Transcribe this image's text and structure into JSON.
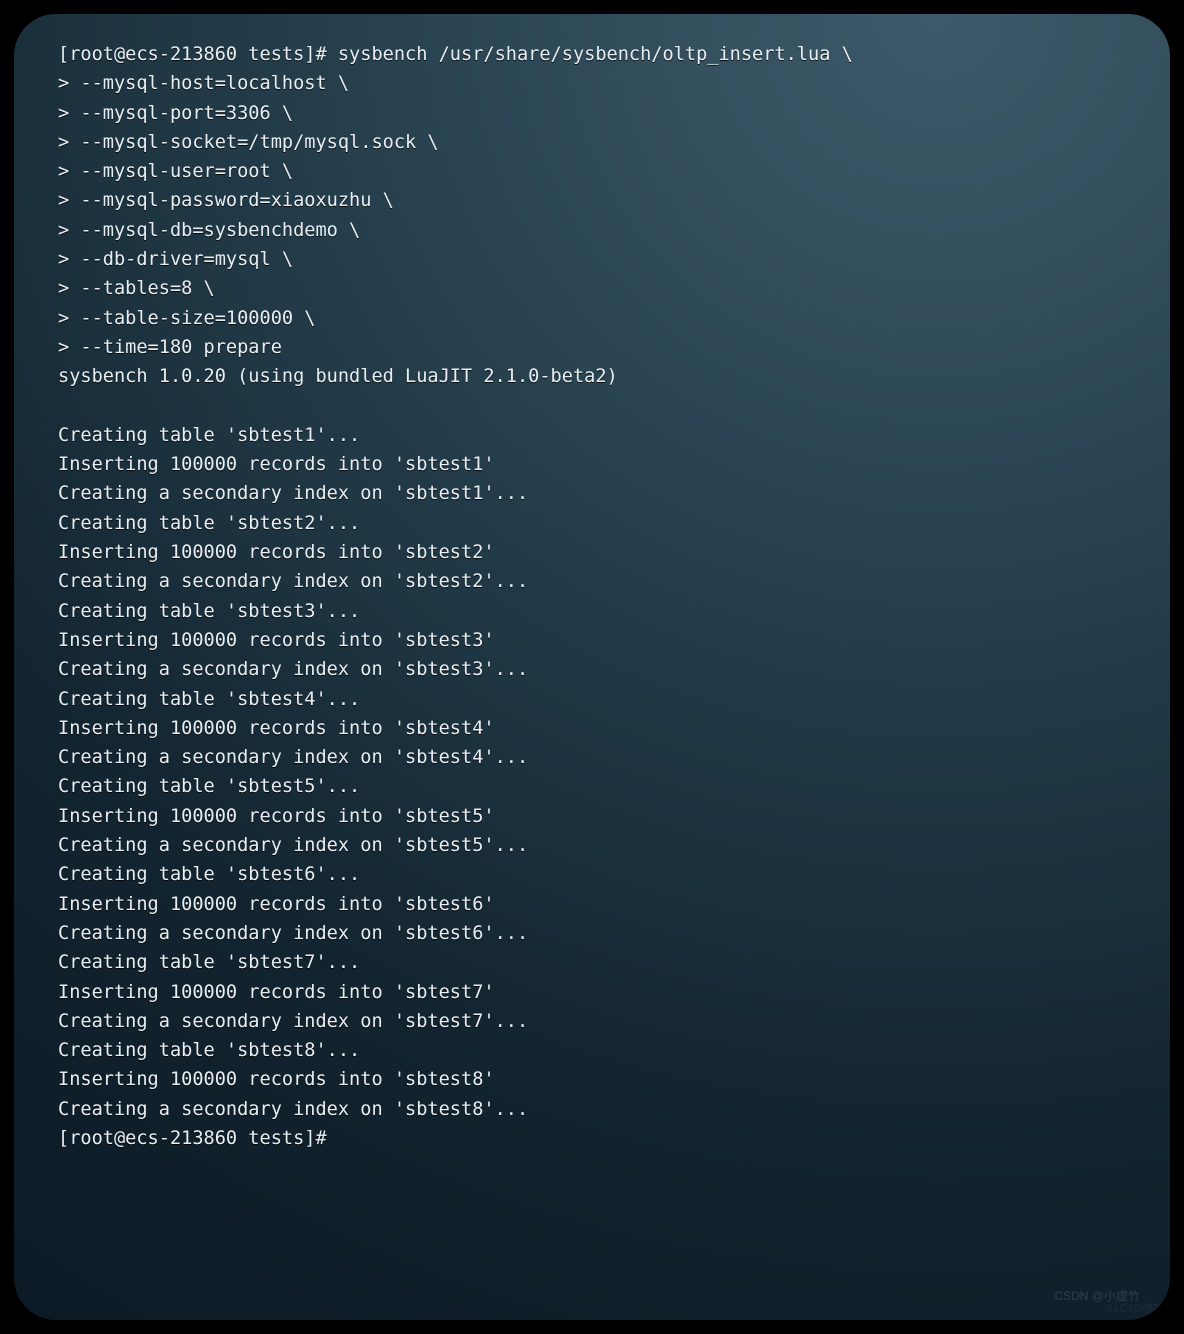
{
  "terminal": {
    "lines": [
      "[root@ecs-213860 tests]# sysbench /usr/share/sysbench/oltp_insert.lua \\",
      "> --mysql-host=localhost \\",
      "> --mysql-port=3306 \\",
      "> --mysql-socket=/tmp/mysql.sock \\",
      "> --mysql-user=root \\",
      "> --mysql-password=xiaoxuzhu \\",
      "> --mysql-db=sysbenchdemo \\",
      "> --db-driver=mysql \\",
      "> --tables=8 \\",
      "> --table-size=100000 \\",
      "> --time=180 prepare",
      "sysbench 1.0.20 (using bundled LuaJIT 2.1.0-beta2)",
      "",
      "Creating table 'sbtest1'...",
      "Inserting 100000 records into 'sbtest1'",
      "Creating a secondary index on 'sbtest1'...",
      "Creating table 'sbtest2'...",
      "Inserting 100000 records into 'sbtest2'",
      "Creating a secondary index on 'sbtest2'...",
      "Creating table 'sbtest3'...",
      "Inserting 100000 records into 'sbtest3'",
      "Creating a secondary index on 'sbtest3'...",
      "Creating table 'sbtest4'...",
      "Inserting 100000 records into 'sbtest4'",
      "Creating a secondary index on 'sbtest4'...",
      "Creating table 'sbtest5'...",
      "Inserting 100000 records into 'sbtest5'",
      "Creating a secondary index on 'sbtest5'...",
      "Creating table 'sbtest6'...",
      "Inserting 100000 records into 'sbtest6'",
      "Creating a secondary index on 'sbtest6'...",
      "Creating table 'sbtest7'...",
      "Inserting 100000 records into 'sbtest7'",
      "Creating a secondary index on 'sbtest7'...",
      "Creating table 'sbtest8'...",
      "Inserting 100000 records into 'sbtest8'",
      "Creating a secondary index on 'sbtest8'...",
      "[root@ecs-213860 tests]# "
    ]
  },
  "watermarks": {
    "bottom": "CSDN @小虚竹",
    "corner": "51CTO博客"
  }
}
